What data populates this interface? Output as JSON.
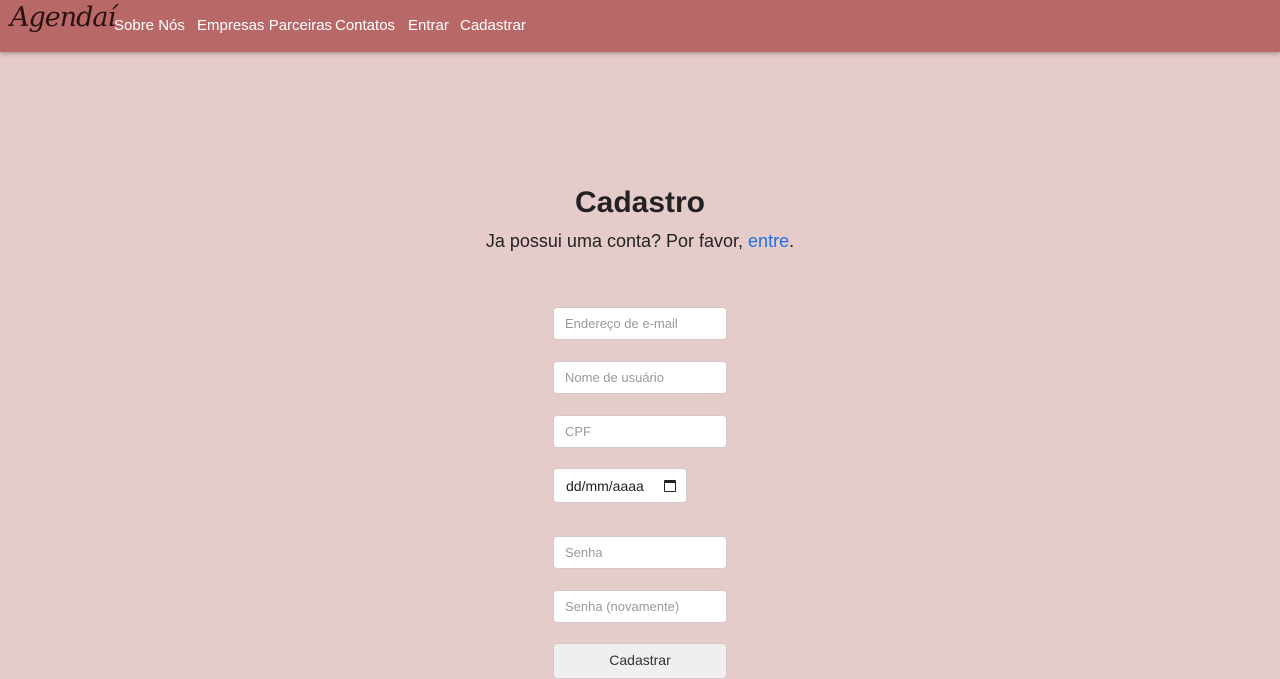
{
  "navbar": {
    "brand": "Agendaí",
    "links": [
      "Sobre Nós",
      "Empresas Parceiras",
      "Contatos",
      "Entrar",
      "Cadastrar"
    ],
    "background_color": "#b96868"
  },
  "main": {
    "title": "Cadastro",
    "subtitle_prefix": "Ja possui uma conta? Por favor, ",
    "login_link": "entre",
    "subtitle_suffix": ".",
    "link_color": "#1f6fe5"
  },
  "form": {
    "email_placeholder": "Endereço de e-mail",
    "username_placeholder": "Nome de usuário",
    "cpf_placeholder": "CPF",
    "date_placeholder": "dd/mm/aaaa",
    "password_placeholder": "Senha",
    "password_confirm_placeholder": "Senha (novamente)",
    "submit_label": "Cadastrar",
    "date_icon": "calendar-icon"
  },
  "page_background": "#e6cbcb"
}
